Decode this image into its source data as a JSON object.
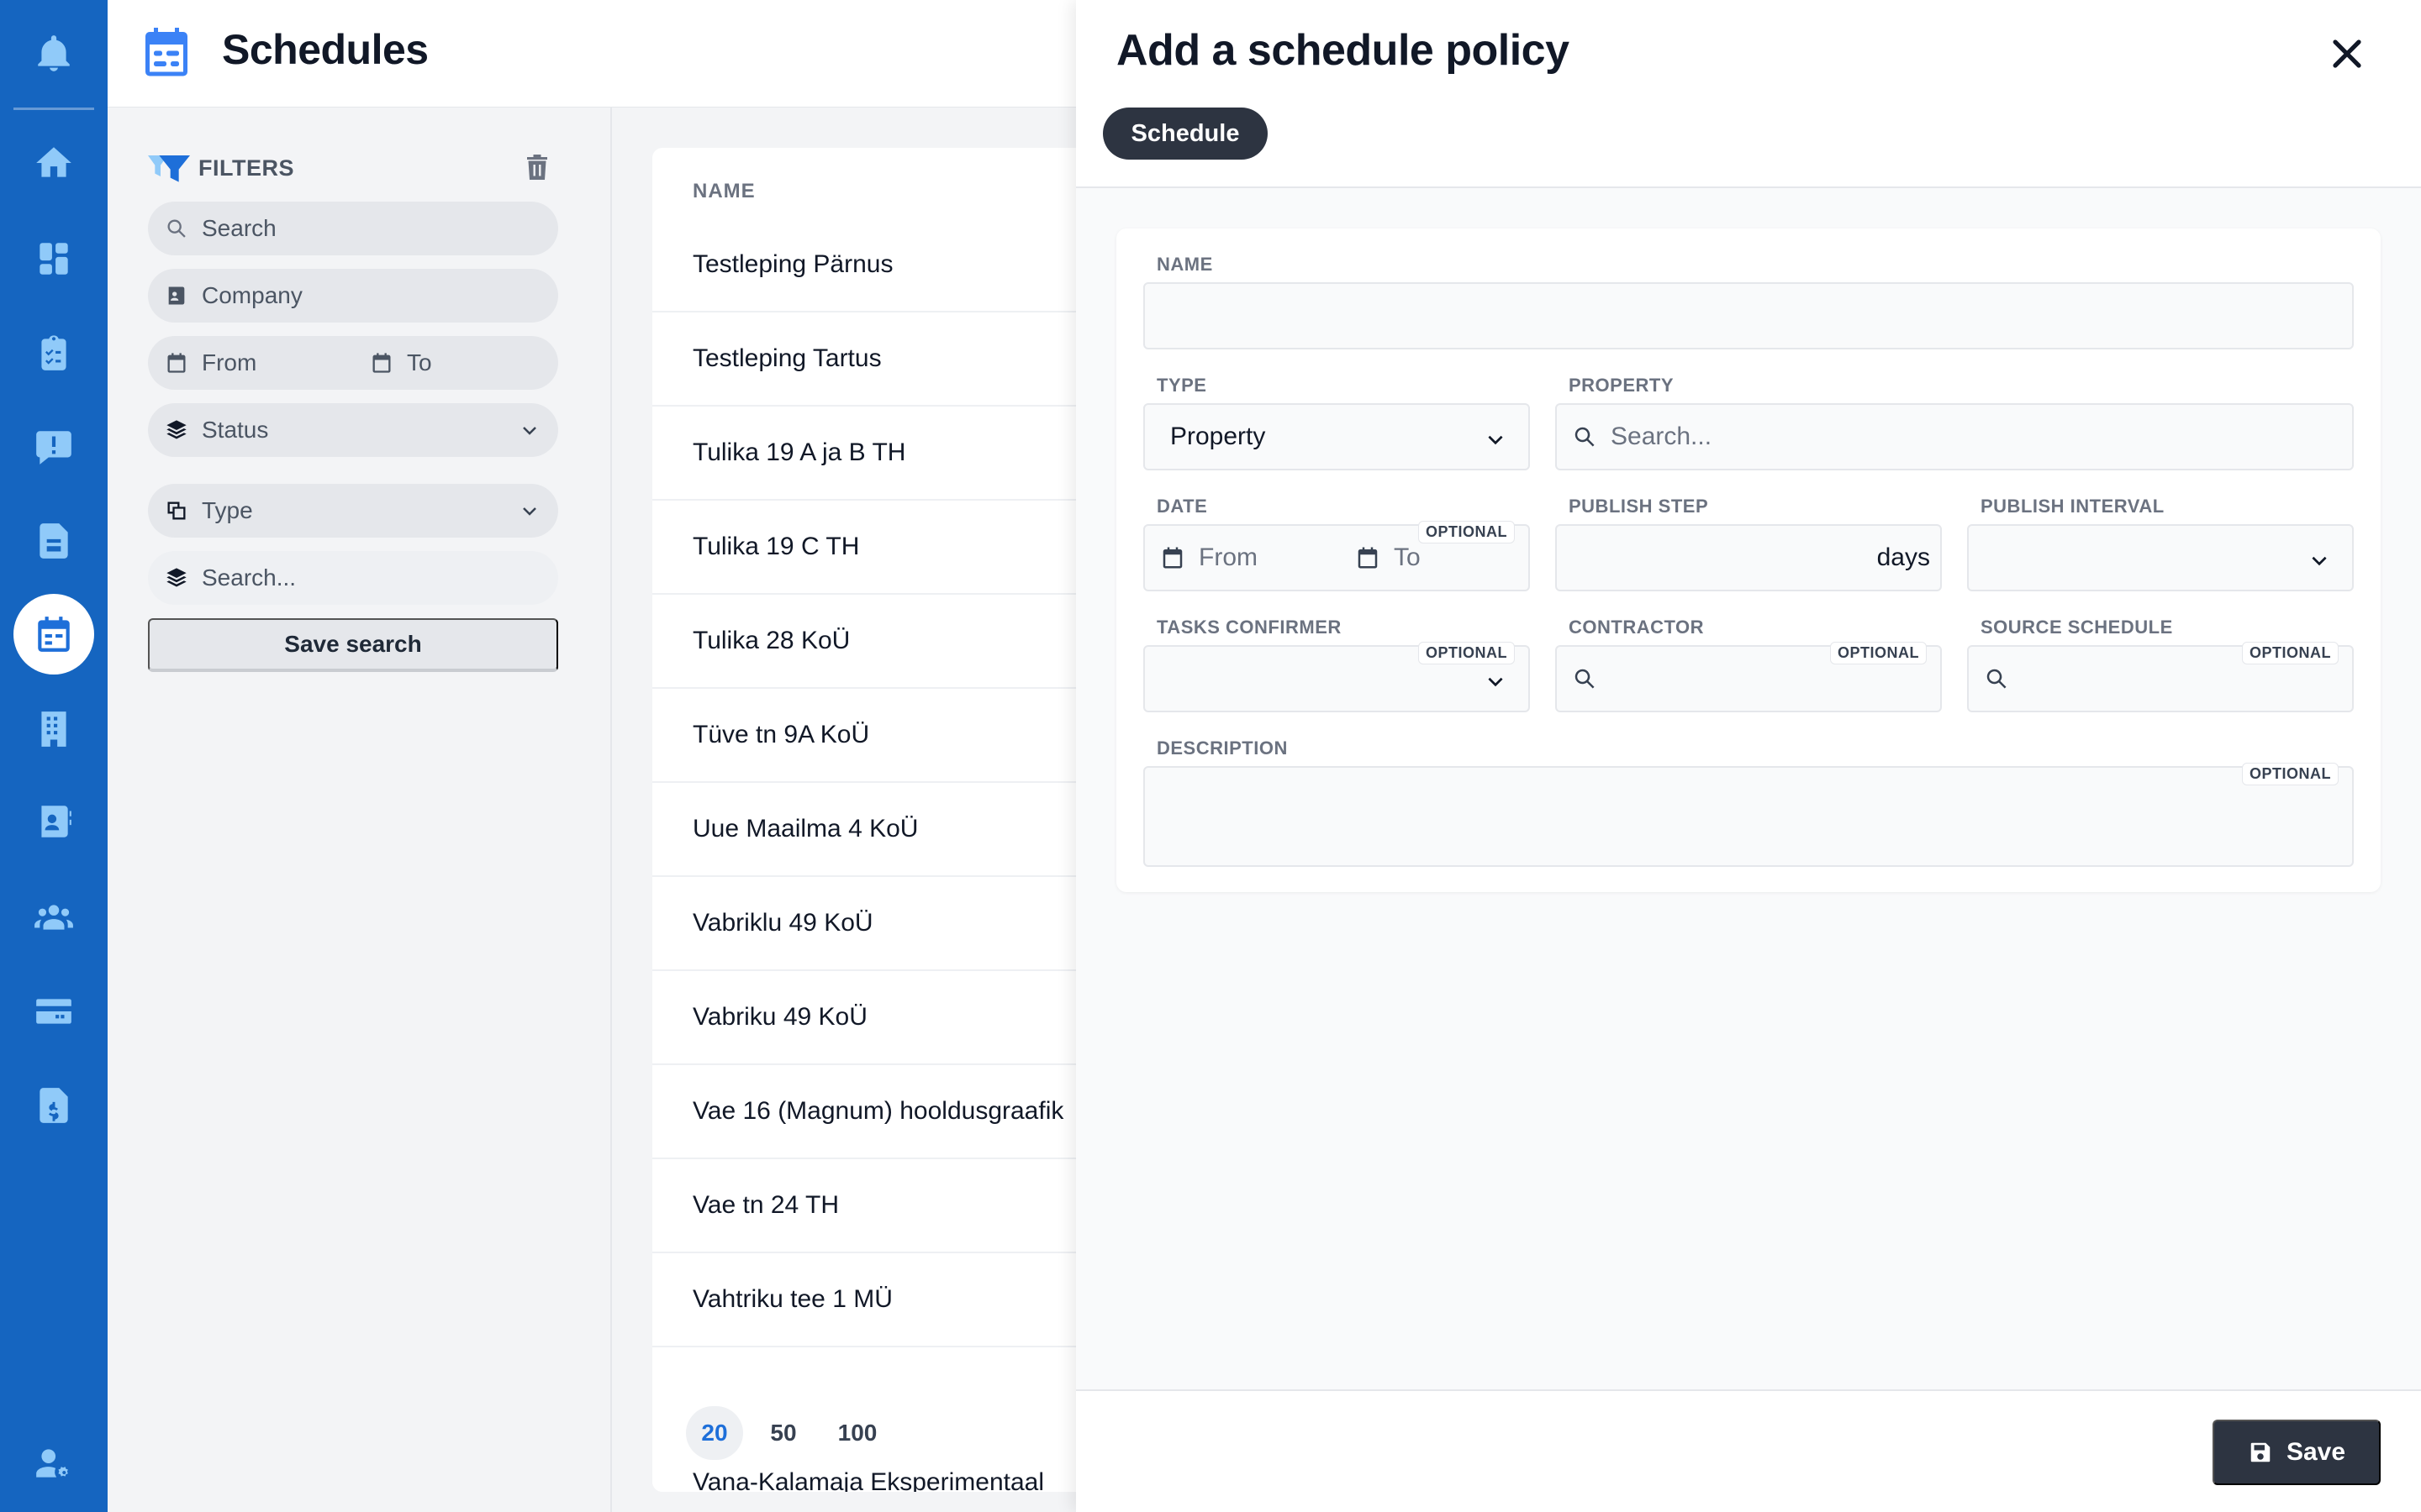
{
  "app": {
    "page_title": "Schedules"
  },
  "rail": {
    "items": [
      "notifications-bell",
      "home",
      "dashboard",
      "tasks-clipboard",
      "issues-alert",
      "documents",
      "schedules",
      "buildings",
      "contacts",
      "users",
      "billing-card",
      "invoices",
      "user-settings"
    ],
    "active": "schedules"
  },
  "filters": {
    "title": "FILTERS",
    "search_placeholder": "Search",
    "company_placeholder": "Company",
    "from_placeholder": "From",
    "to_placeholder": "To",
    "status_placeholder": "Status",
    "type_placeholder": "Type",
    "search2_placeholder": "Search...",
    "save_search_label": "Save search"
  },
  "list": {
    "column_name": "NAME",
    "rows": [
      "Testleping Pärnus",
      "Testleping Tartus",
      "Tulika 19 A ja B TH",
      "Tulika 19 C TH",
      "Tulika 28 KoÜ",
      "Tüve tn 9A KoÜ",
      "Uue Maailma 4 KoÜ",
      "Vabriklu 49 KoÜ",
      "Vabriku 49 KoÜ",
      "Vae 16 (Magnum) hooldusgraafik",
      "Vae tn 24 TH",
      "Vahtriku tee 1 MÜ"
    ],
    "peek_row": "Vana-Kalamaja Eksperimentaal",
    "page_sizes": [
      "20",
      "50",
      "100"
    ],
    "active_page_size": "20"
  },
  "drawer": {
    "title": "Add a schedule policy",
    "tab_label": "Schedule",
    "optional_label": "OPTIONAL",
    "fields": {
      "name_label": "NAME",
      "name_value": "",
      "type_label": "TYPE",
      "type_value": "Property",
      "property_label": "PROPERTY",
      "property_placeholder": "Search...",
      "date_label": "DATE",
      "date_from_placeholder": "From",
      "date_to_placeholder": "To",
      "publish_step_label": "PUBLISH STEP",
      "publish_step_suffix": "days",
      "publish_interval_label": "PUBLISH INTERVAL",
      "tasks_confirmer_label": "TASKS CONFIRMER",
      "contractor_label": "CONTRACTOR",
      "source_schedule_label": "SOURCE SCHEDULE",
      "description_label": "DESCRIPTION"
    },
    "save_label": "Save"
  },
  "colors": {
    "rail": "#1565c0",
    "accent": "#1e6fd9",
    "dark_button": "#2d3441"
  }
}
